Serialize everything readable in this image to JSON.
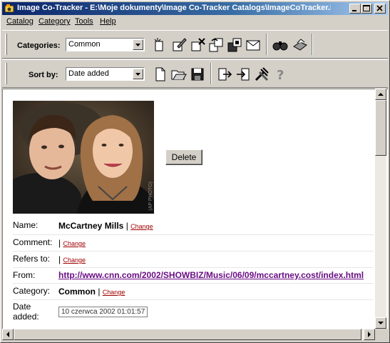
{
  "window": {
    "title": "Image Co-Tracker - E:\\Moje dokumenty\\Image Co-Tracker Catalogs\\ImageCoTracker.ic"
  },
  "menu": [
    "Catalog",
    "Category",
    "Tools",
    "Help"
  ],
  "toolbar": {
    "categories_label": "Categories:",
    "categories_value": "Common",
    "sortby_label": "Sort by:",
    "sortby_value": "Date added",
    "row1_icons": [
      "new-category-icon",
      "edit-category-icon",
      "delete-category-icon",
      "copy-category-icon",
      "move-category-icon",
      "email-category-icon",
      "find-icon",
      "print-icon"
    ],
    "row2_icons": [
      "new-document-icon",
      "open-folder-icon",
      "save-icon",
      "export-icon",
      "import-icon",
      "tools-icon",
      "help-icon"
    ]
  },
  "image": {
    "caption": "(AP PHOTO)"
  },
  "delete_label": "Delete",
  "details": {
    "change_label": "Change",
    "name_label": "Name:",
    "name_value": "McCartney Mills",
    "comment_label": "Comment:",
    "refers_label": "Refers to:",
    "from_label": "From:",
    "from_value": "http://www.cnn.com/2002/SHOWBIZ/Music/06/09/mccartney.cost/index.html",
    "category_label": "Category:",
    "category_value": "Common",
    "date_label": "Date added:",
    "date_value": "10 czerwca 2002 01:01:57"
  }
}
